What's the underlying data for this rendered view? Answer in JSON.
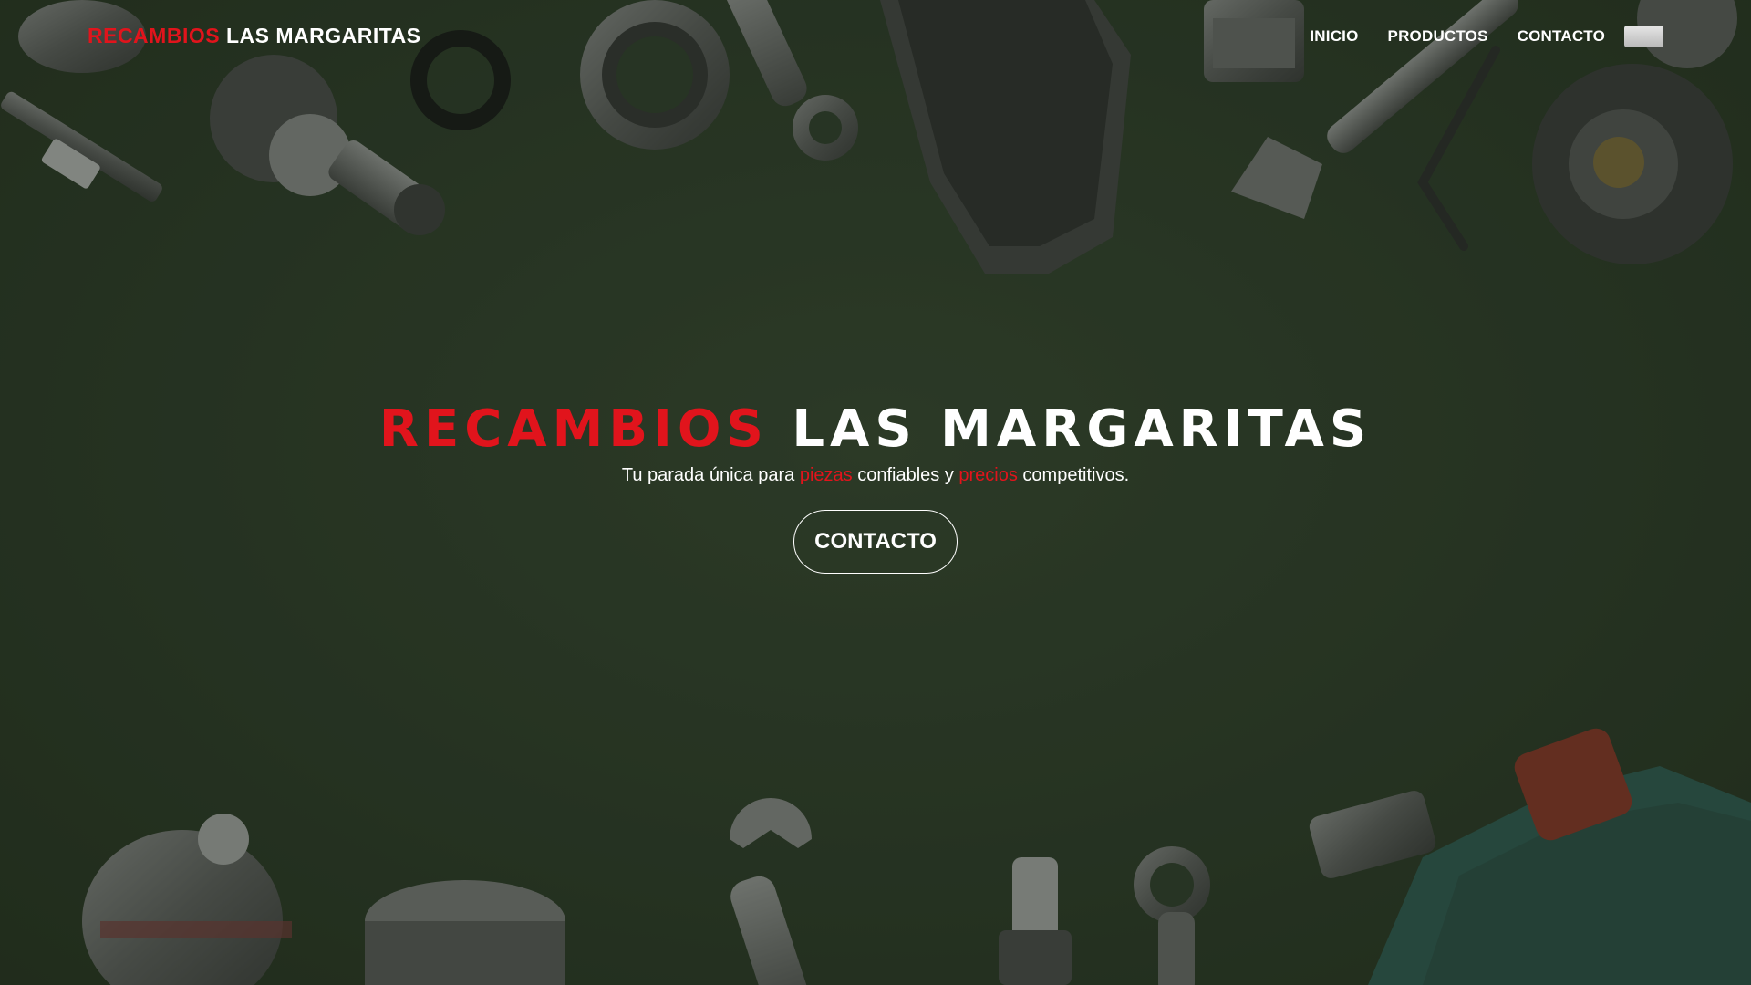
{
  "nav": {
    "brand_accent": "RECAMBIOS",
    "brand_rest": "LAS MARGARITAS",
    "links": [
      {
        "label": "INICIO"
      },
      {
        "label": "PRODUCTOS"
      },
      {
        "label": "CONTACTO"
      }
    ]
  },
  "hero": {
    "title_accent": "RECAMBIOS",
    "title_rest": "LAS MARGARITAS",
    "tagline_part1": "Tu parada única para ",
    "tagline_accent1": "piezas",
    "tagline_part2": " confiables y ",
    "tagline_accent2": "precios",
    "tagline_part3": " competitivos.",
    "cta_label": "CONTACTO"
  },
  "colors": {
    "accent": "#e1141c",
    "background": "#2f3d2b",
    "text": "#ffffff"
  },
  "decor_icons": [
    "spark-plug-icon",
    "bearing-icon",
    "seal-ring-icon",
    "wrench-icon",
    "brake-pad-icon",
    "gear-icon",
    "thermostat-icon",
    "hex-key-icon",
    "fuel-pump-icon",
    "oil-filter-icon",
    "bulb-icon",
    "socket-icon",
    "oil-bottle-icon"
  ]
}
